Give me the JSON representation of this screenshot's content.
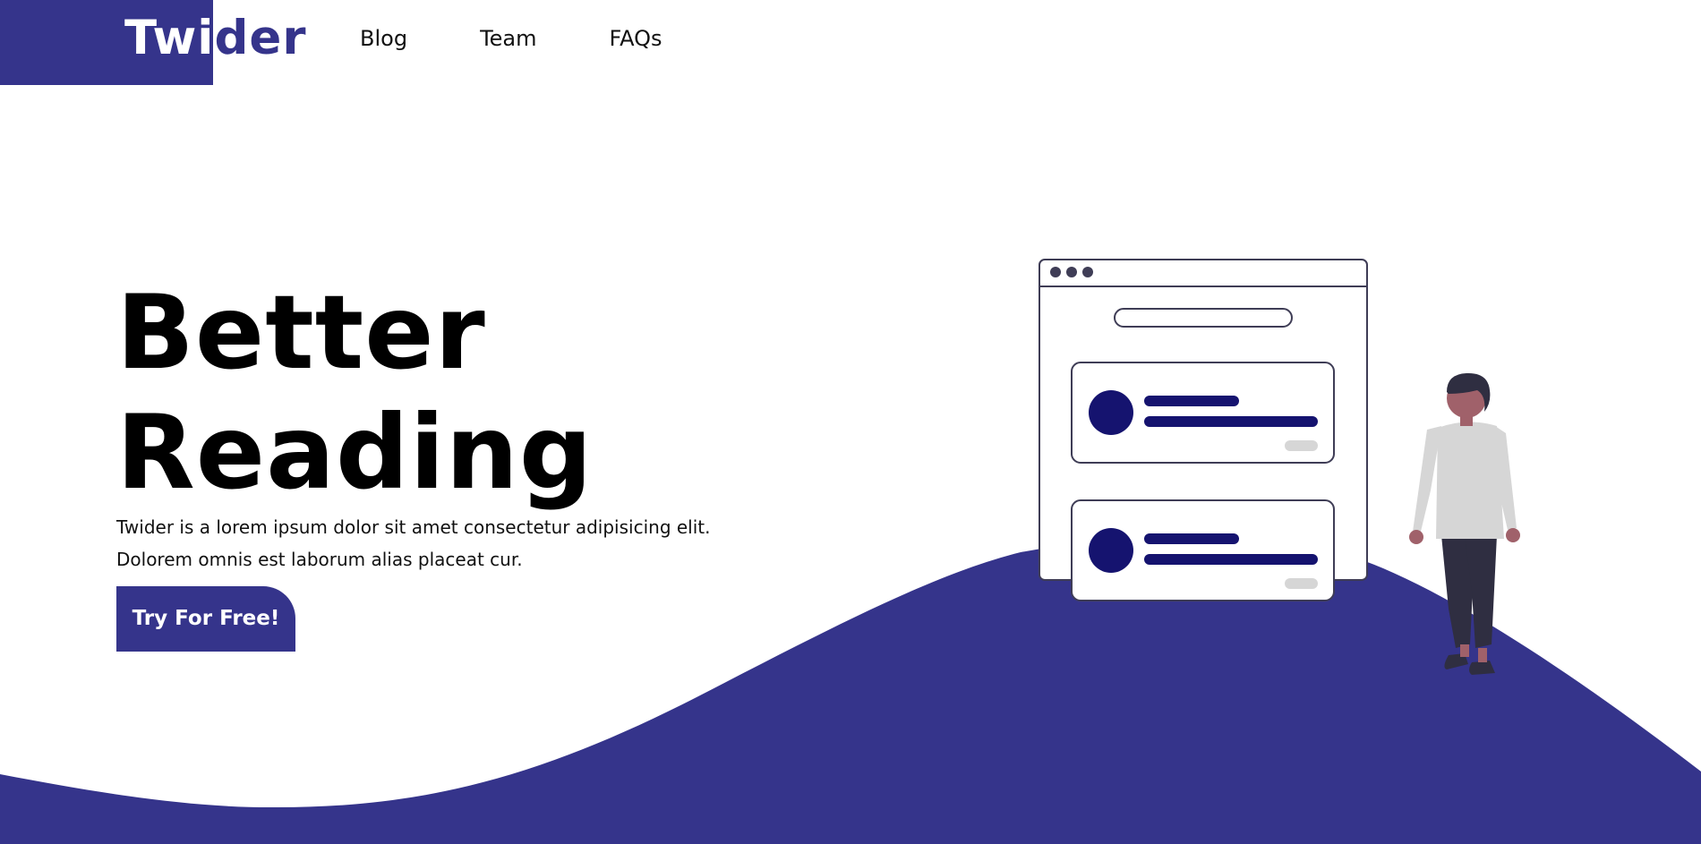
{
  "brand": {
    "name": "Twider",
    "accent_color": "#35348b",
    "illustration_color": "#15136f"
  },
  "nav": {
    "items": [
      {
        "label": "Blog"
      },
      {
        "label": "Team"
      },
      {
        "label": "FAQs"
      }
    ]
  },
  "hero": {
    "title_line1": "Better",
    "title_line2": "Reading",
    "description_line1": "Twider is a lorem ipsum dolor sit amet consectetur adipisicing elit.",
    "description_line2": "Dolorem omnis est laborum alias placeat cur.",
    "cta_label": "Try For Free!"
  },
  "illustration": {
    "browser_dots": 3,
    "cards": 2,
    "person_icon": "person-standing-icon"
  }
}
